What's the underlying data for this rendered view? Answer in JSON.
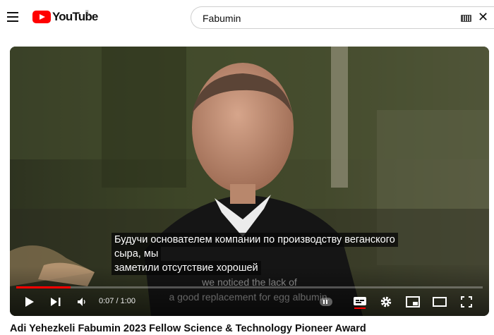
{
  "header": {
    "logo_text": "YouTube",
    "country_code": "IL",
    "search_value": "Fabumin",
    "icons": [
      "menu-icon",
      "youtube-logo-icon",
      "keyboard-icon",
      "clear-icon"
    ]
  },
  "player": {
    "subtitle_lines": [
      "Будучи основателем компании по производству веганского",
      "сыра, мы",
      "заметили отсутствие хорошей"
    ],
    "burned_caption_lines": [
      "we noticed the lack of",
      "a good replacement for egg albumin."
    ],
    "time_display": "0:07 / 1:00",
    "progress_fraction": 0.117,
    "colors": {
      "progress": "#ff0000",
      "subtitle_bg": "#080808"
    },
    "control_icons": [
      "play-icon",
      "next-icon",
      "volume-icon",
      "pause-toggle-icon",
      "subtitles-icon",
      "settings-icon",
      "miniplayer-icon",
      "theater-icon",
      "fullscreen-icon"
    ]
  },
  "video": {
    "title": "Adi Yehezkeli Fabumin 2023 Fellow Science & Technology Pioneer Award"
  }
}
